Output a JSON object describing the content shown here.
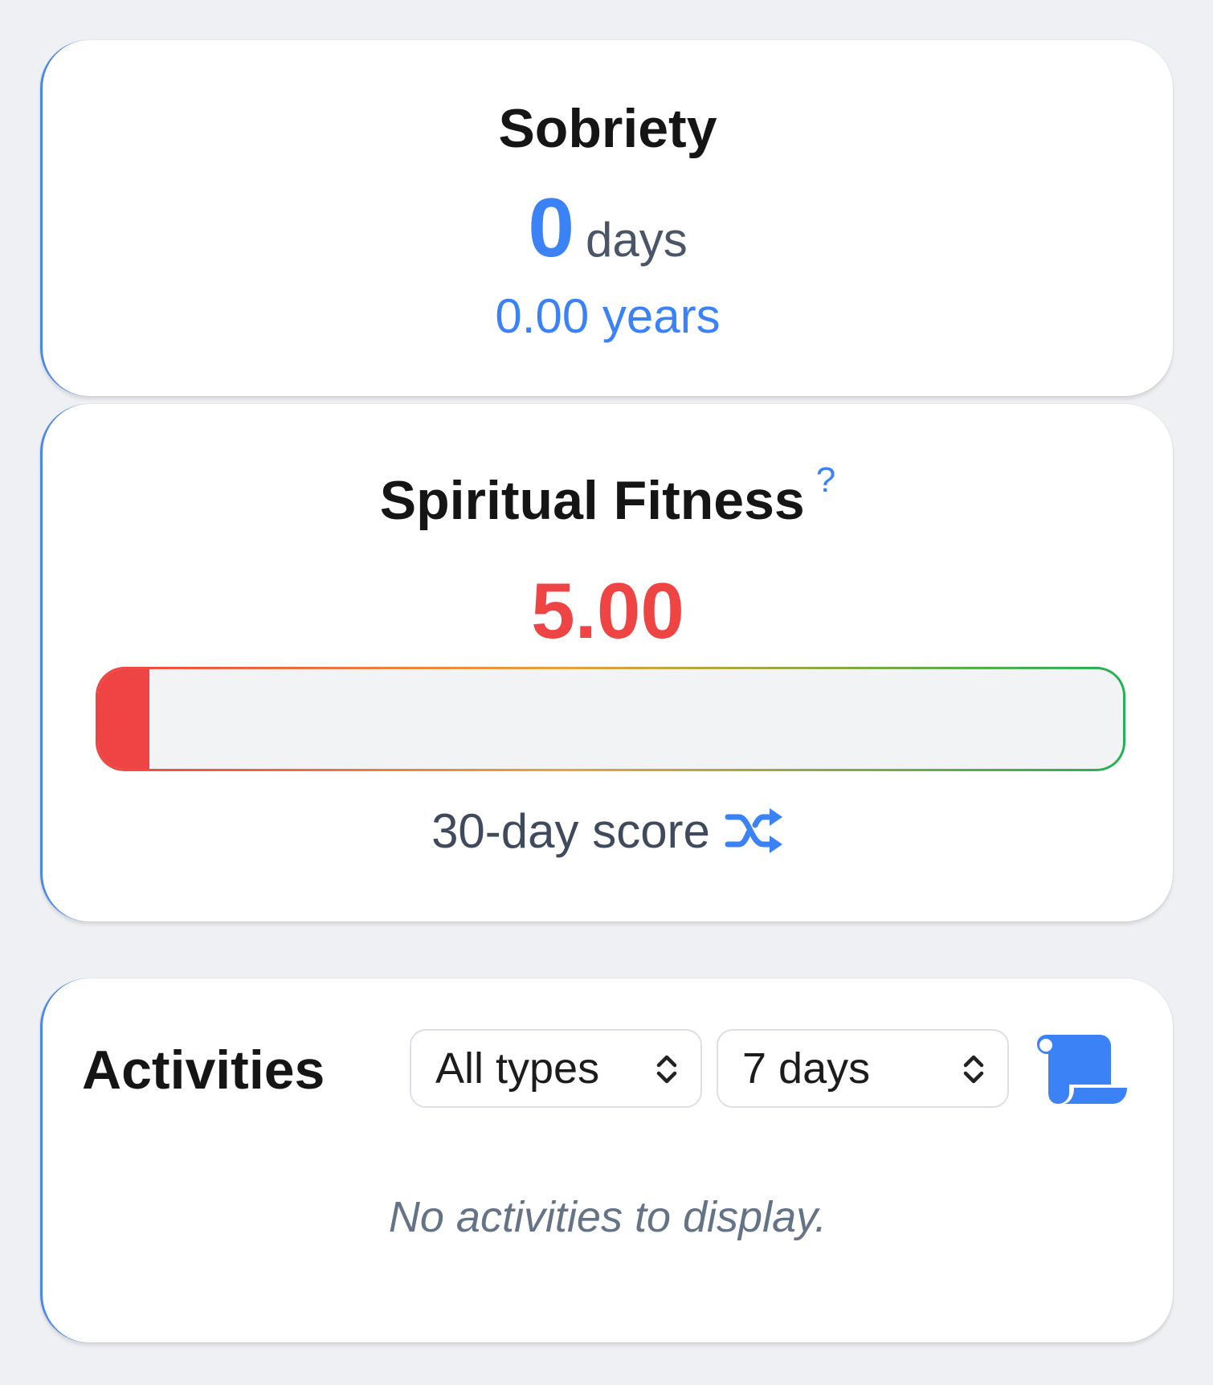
{
  "sobriety": {
    "title": "Sobriety",
    "days_value": "0",
    "days_unit": "days",
    "years_text": "0.00 years"
  },
  "fitness": {
    "title": "Spiritual Fitness",
    "help_mark": "?",
    "score": "5.00",
    "progress_fraction": 0.05,
    "caption": "30-day score",
    "caption_icon": "shuffle-icon"
  },
  "activities": {
    "title": "Activities",
    "type_filter": "All types",
    "range_filter": "7 days",
    "history_icon": "scroll-icon",
    "empty_message": "No activities to display."
  },
  "colors": {
    "accent": "#3b82f6",
    "score_low": "#ef4444",
    "score_high": "#22b153"
  }
}
